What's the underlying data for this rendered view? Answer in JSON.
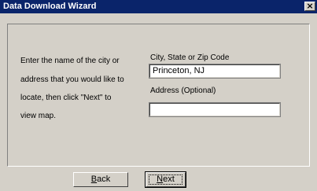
{
  "window": {
    "title": "Data Download Wizard",
    "close_glyph": "×",
    "close_icon": "close-icon"
  },
  "instructions": {
    "line1": "Enter the name of the city or",
    "line2": "address that you would like to",
    "line3": "locate, then click \"Next\" to",
    "line4": "view map."
  },
  "city_field": {
    "label": "City, State or Zip Code",
    "value": "Princeton, NJ"
  },
  "address_field": {
    "label": "Address (Optional)",
    "value": ""
  },
  "buttons": {
    "back_mnemonic": "B",
    "back_rest": "ack",
    "next_mnemonic": "N",
    "next_rest": "ext"
  },
  "colors": {
    "title_bar": "#0a246a",
    "face": "#d4d0c8"
  }
}
